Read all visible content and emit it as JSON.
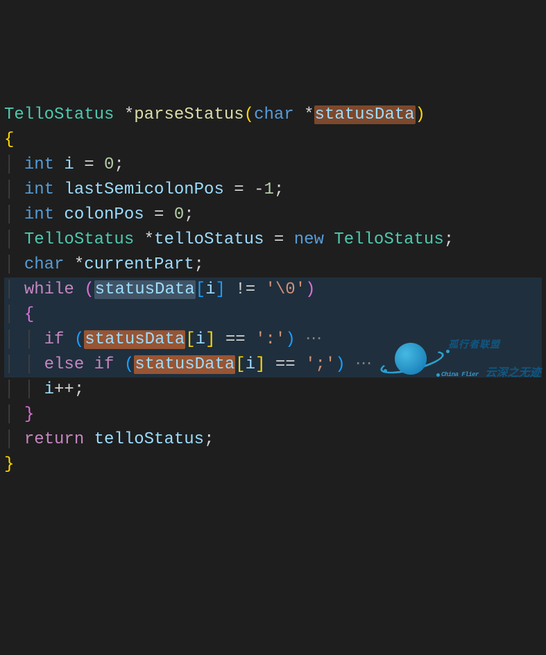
{
  "code": {
    "lines": [
      {
        "highlight": false,
        "tokens": [
          {
            "t": "TelloStatus ",
            "cls": "tk-type"
          },
          {
            "t": "*",
            "cls": "tk-op"
          },
          {
            "t": "parseStatus",
            "cls": "tk-func"
          },
          {
            "t": "(",
            "cls": "tk-brace"
          },
          {
            "t": "char ",
            "cls": "tk-keyword"
          },
          {
            "t": "*",
            "cls": "tk-op"
          },
          {
            "t": "statusData",
            "cls": "tk-var",
            "mark": "hl-param"
          },
          {
            "t": ")",
            "cls": "tk-brace"
          }
        ]
      },
      {
        "highlight": false,
        "tokens": [
          {
            "t": "{",
            "cls": "tk-brace"
          }
        ]
      },
      {
        "highlight": false,
        "tokens": [
          {
            "t": "│ ",
            "cls": "tk-indent"
          },
          {
            "t": "int ",
            "cls": "tk-keyword"
          },
          {
            "t": "i",
            "cls": "tk-var"
          },
          {
            "t": " = ",
            "cls": "tk-op"
          },
          {
            "t": "0",
            "cls": "tk-num"
          },
          {
            "t": ";",
            "cls": "tk-punct"
          }
        ]
      },
      {
        "highlight": false,
        "tokens": [
          {
            "t": "│ ",
            "cls": "tk-indent"
          },
          {
            "t": "int ",
            "cls": "tk-keyword"
          },
          {
            "t": "lastSemicolonPos",
            "cls": "tk-var"
          },
          {
            "t": " = -",
            "cls": "tk-op"
          },
          {
            "t": "1",
            "cls": "tk-num"
          },
          {
            "t": ";",
            "cls": "tk-punct"
          }
        ]
      },
      {
        "highlight": false,
        "tokens": [
          {
            "t": "│ ",
            "cls": "tk-indent"
          },
          {
            "t": "int ",
            "cls": "tk-keyword"
          },
          {
            "t": "colonPos",
            "cls": "tk-var"
          },
          {
            "t": " = ",
            "cls": "tk-op"
          },
          {
            "t": "0",
            "cls": "tk-num"
          },
          {
            "t": ";",
            "cls": "tk-punct"
          }
        ]
      },
      {
        "highlight": false,
        "tokens": [
          {
            "t": "│ ",
            "cls": "tk-indent"
          },
          {
            "t": "TelloStatus ",
            "cls": "tk-type"
          },
          {
            "t": "*",
            "cls": "tk-op"
          },
          {
            "t": "telloStatus",
            "cls": "tk-var"
          },
          {
            "t": " = ",
            "cls": "tk-op"
          },
          {
            "t": "new ",
            "cls": "tk-keyword"
          },
          {
            "t": "TelloStatus",
            "cls": "tk-type"
          },
          {
            "t": ";",
            "cls": "tk-punct"
          }
        ]
      },
      {
        "highlight": false,
        "tokens": [
          {
            "t": "│ ",
            "cls": "tk-indent"
          },
          {
            "t": "char ",
            "cls": "tk-keyword"
          },
          {
            "t": "*",
            "cls": "tk-op"
          },
          {
            "t": "currentPart",
            "cls": "tk-var"
          },
          {
            "t": ";",
            "cls": "tk-punct"
          }
        ]
      },
      {
        "highlight": true,
        "tokens": [
          {
            "t": "│ ",
            "cls": "tk-indent"
          },
          {
            "t": "while ",
            "cls": "tk-keyword2"
          },
          {
            "t": "(",
            "cls": "tk-brace2"
          },
          {
            "t": "statusData",
            "cls": "tk-var",
            "mark": "hl-sel"
          },
          {
            "t": "[",
            "cls": "tk-brace3"
          },
          {
            "t": "i",
            "cls": "tk-var"
          },
          {
            "t": "]",
            "cls": "tk-brace3"
          },
          {
            "t": " != ",
            "cls": "tk-op"
          },
          {
            "t": "'\\0'",
            "cls": "tk-str"
          },
          {
            "t": ")",
            "cls": "tk-brace2"
          }
        ]
      },
      {
        "highlight": true,
        "tokens": [
          {
            "t": "│ ",
            "cls": "tk-indent"
          },
          {
            "t": "{",
            "cls": "tk-brace2"
          }
        ]
      },
      {
        "highlight": true,
        "tokens": [
          {
            "t": "│ │ ",
            "cls": "tk-indent"
          },
          {
            "t": "if ",
            "cls": "tk-keyword2"
          },
          {
            "t": "(",
            "cls": "tk-brace3"
          },
          {
            "t": "statusData",
            "cls": "tk-var",
            "mark": "hl-param2"
          },
          {
            "t": "[",
            "cls": "tk-brace"
          },
          {
            "t": "i",
            "cls": "tk-var"
          },
          {
            "t": "]",
            "cls": "tk-brace"
          },
          {
            "t": " == ",
            "cls": "tk-op"
          },
          {
            "t": "':'",
            "cls": "tk-str"
          },
          {
            "t": ")",
            "cls": "tk-brace3"
          },
          {
            "t": " ⋯",
            "cls": "tk-dim"
          }
        ]
      },
      {
        "highlight": true,
        "tokens": [
          {
            "t": "│ │ ",
            "cls": "tk-indent"
          },
          {
            "t": "else if ",
            "cls": "tk-keyword2"
          },
          {
            "t": "(",
            "cls": "tk-brace3"
          },
          {
            "t": "statusData",
            "cls": "tk-var",
            "mark": "hl-param2"
          },
          {
            "t": "[",
            "cls": "tk-brace"
          },
          {
            "t": "i",
            "cls": "tk-var"
          },
          {
            "t": "]",
            "cls": "tk-brace"
          },
          {
            "t": " == ",
            "cls": "tk-op"
          },
          {
            "t": "';'",
            "cls": "tk-str"
          },
          {
            "t": ")",
            "cls": "tk-brace3"
          },
          {
            "t": " ⋯",
            "cls": "tk-dim"
          }
        ]
      },
      {
        "highlight": false,
        "tokens": [
          {
            "t": "│ │ ",
            "cls": "tk-indent"
          },
          {
            "t": "i",
            "cls": "tk-var"
          },
          {
            "t": "++;",
            "cls": "tk-op"
          }
        ]
      },
      {
        "highlight": false,
        "tokens": [
          {
            "t": "│ ",
            "cls": "tk-indent"
          },
          {
            "t": "}",
            "cls": "tk-brace2"
          }
        ]
      },
      {
        "highlight": false,
        "tokens": [
          {
            "t": "│ ",
            "cls": "tk-indent"
          },
          {
            "t": "return ",
            "cls": "tk-keyword2"
          },
          {
            "t": "telloStatus",
            "cls": "tk-var"
          },
          {
            "t": ";",
            "cls": "tk-punct"
          }
        ]
      },
      {
        "highlight": false,
        "tokens": [
          {
            "t": "}",
            "cls": "tk-brace"
          }
        ]
      }
    ]
  },
  "watermark": {
    "text_top": "孤行者联盟",
    "text_bottom": "云深之无迹",
    "brand_latin": "China Flier"
  }
}
